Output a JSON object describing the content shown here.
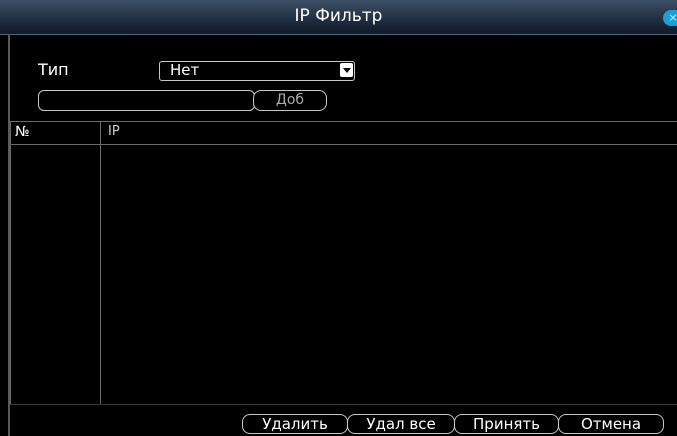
{
  "window": {
    "title": "IP Фильтр",
    "close_glyph": "×"
  },
  "form": {
    "type_label": "Тип",
    "type_value": "Нет",
    "ip_value": "",
    "add_button": "Доб"
  },
  "table": {
    "columns": [
      "№",
      "IP"
    ],
    "rows": []
  },
  "footer": {
    "delete_button": "Удалить",
    "delete_all_button": "Удал все",
    "accept_button": "Принять",
    "cancel_button": "Отмена"
  }
}
